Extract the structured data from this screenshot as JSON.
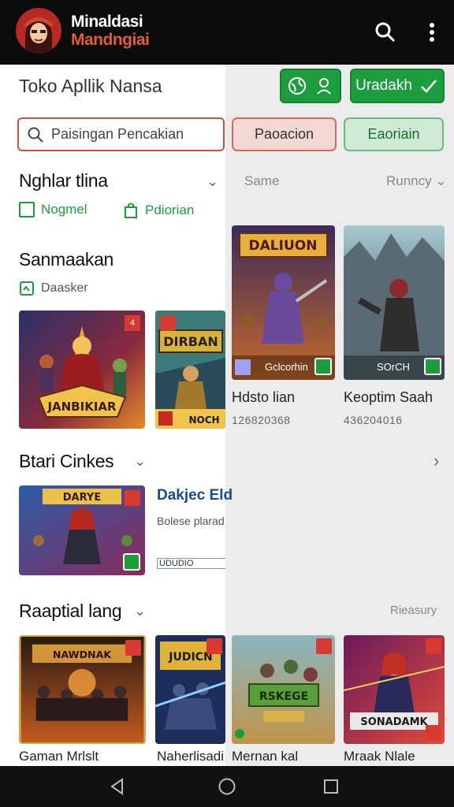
{
  "app": {
    "brand_line1": "Minaldasi",
    "brand_line2": "Mandngiai",
    "store_title": "Toko Apllik Nansa"
  },
  "header_buttons": {
    "green_small_label": "",
    "green_download_label": "Uradakh"
  },
  "search": {
    "placeholder": "Paisingan Pencakian"
  },
  "pills": {
    "red": "Paoacion",
    "green": "Eaoriain"
  },
  "section1": {
    "title": "Nghlar tlina",
    "right_col_label": "Same",
    "right_col_sort": "Runncy",
    "filter1": "Nogmel",
    "filter2": "Pdiorian"
  },
  "section2": {
    "title": "Sanmaakan",
    "subtitle": "Daasker",
    "cards": [
      {
        "label": "Hdsto lian",
        "number": "126820368",
        "caption": "Gclcorhin"
      },
      {
        "label": "Keoptim Saah",
        "number": "436204016",
        "caption": "SOrCH"
      }
    ],
    "card_texts": [
      "JANBIKIAR",
      "DIRBAN",
      "NOCH",
      "DALIUON"
    ]
  },
  "section3": {
    "title": "Btari Cinkes",
    "feature_title": "Dakjec Eld",
    "feature_sub": "Bolese plarad",
    "feature_link": "UDUDIO",
    "card_text": "DARYE"
  },
  "section4": {
    "title": "Raaptial lang",
    "right_label": "Rieasury",
    "cards": [
      {
        "label": "Gaman Mrlslt",
        "art": "NAWDNAK"
      },
      {
        "label": "Naherlisadi",
        "art": "JUDICN"
      },
      {
        "label": "Mernan kal",
        "art": "RSKEGE"
      },
      {
        "label": "Mraak Nlale",
        "art": "SONADAMK"
      }
    ]
  },
  "colors": {
    "accent_green": "#1d9e3e",
    "accent_red": "#d94f35",
    "brand_orange": "#e65b2f"
  }
}
